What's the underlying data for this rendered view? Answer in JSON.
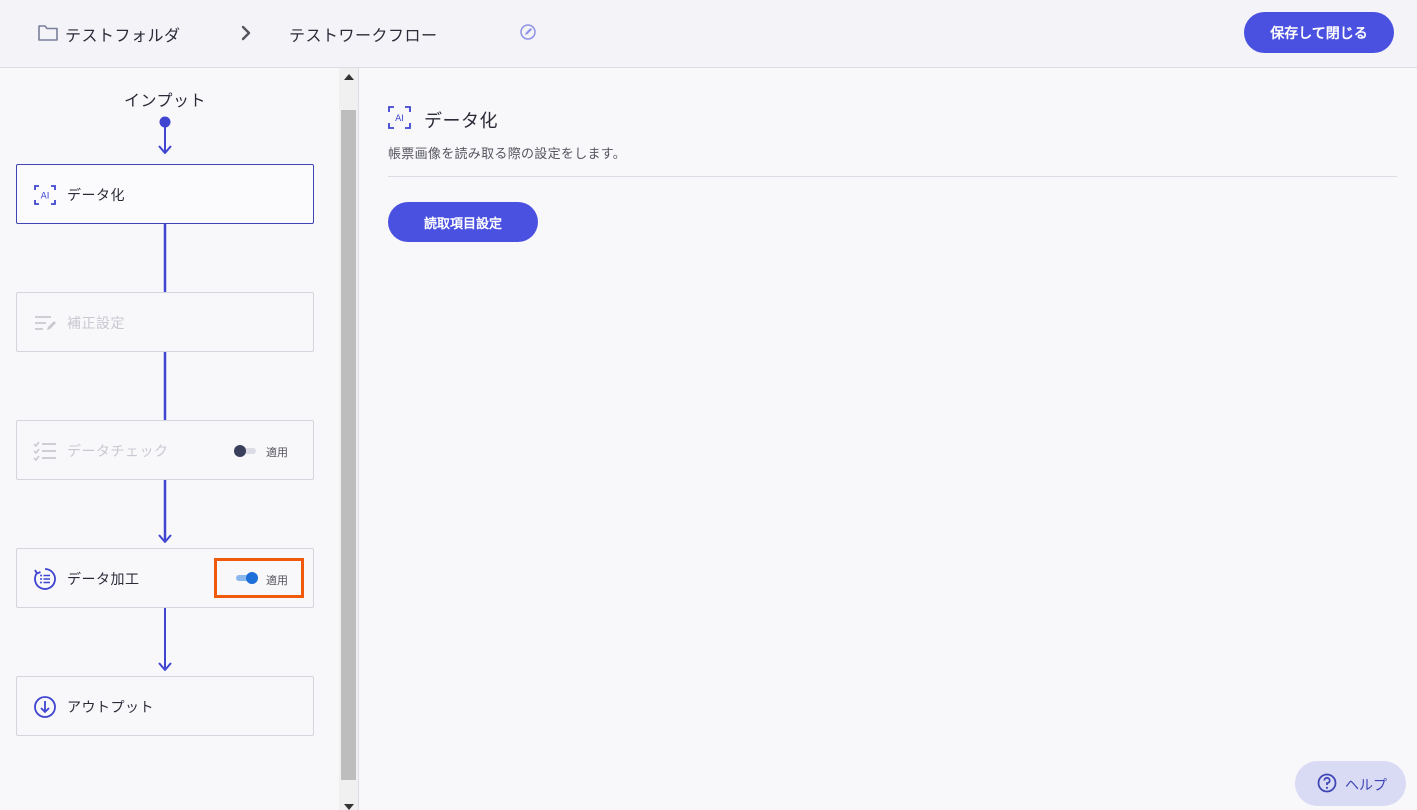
{
  "header": {
    "folder_icon": "folder-icon",
    "folder_name": "テストフォルダ",
    "separator_icon": "chevron-right-icon",
    "workflow_name": "テストワークフロー",
    "edit_icon": "edit-icon",
    "save_button": "保存して閉じる"
  },
  "flow": {
    "input_label": "インプット",
    "nodes": [
      {
        "label": "データ化",
        "icon": "ai-scan-icon",
        "state": "active"
      },
      {
        "label": "補正設定",
        "icon": "correction-icon",
        "state": "disabled"
      },
      {
        "label": "データチェック",
        "icon": "checklist-icon",
        "state": "disabled",
        "toggle": {
          "label": "適用",
          "on": false
        }
      },
      {
        "label": "データ加工",
        "icon": "processing-icon",
        "state": "normal",
        "toggle": {
          "label": "適用",
          "on": true
        }
      },
      {
        "label": "アウトプット",
        "icon": "download-circle-icon",
        "state": "normal"
      }
    ]
  },
  "detail": {
    "icon": "ai-scan-icon",
    "title": "データ化",
    "description": "帳票画像を読み取る際の設定をします。",
    "read_items_button": "読取項目設定"
  },
  "help": {
    "icon": "question-circle-icon",
    "label": "ヘルプ"
  },
  "colors": {
    "accent": "#4a50e0",
    "highlight": "#f05a0a"
  }
}
